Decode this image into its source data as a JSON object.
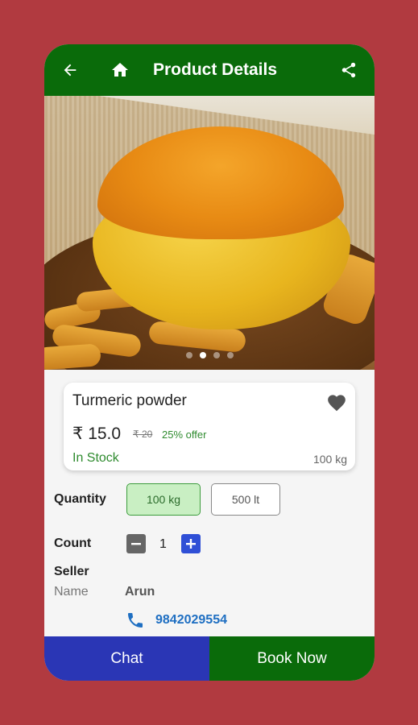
{
  "appbar": {
    "title": "Product Details",
    "back_icon": "arrow-left-icon",
    "home_icon": "home-icon",
    "share_icon": "share-icon"
  },
  "carousel": {
    "image_description": "turmeric powder in yellow bowl",
    "slides": 4,
    "active_index": 1
  },
  "product": {
    "name": "Turmeric powder",
    "price": "₹ 15.0",
    "old_price": "₹ 20",
    "offer": "25% offer",
    "stock": "In Stock",
    "weight": "100 kg"
  },
  "quantity": {
    "label": "Quantity",
    "options": [
      "100 kg",
      "500 lt"
    ],
    "selected": "100 kg"
  },
  "count": {
    "label": "Count",
    "value": "1"
  },
  "seller": {
    "label": "Seller",
    "name_key": "Name",
    "name_value": "Arun",
    "phone": "9842029554"
  },
  "actions": {
    "chat": "Chat",
    "book_now": "Book Now"
  },
  "colors": {
    "background": "#b13a40",
    "appbar": "#0a6b0a",
    "chat_button": "#2a36b5",
    "book_button": "#0a6b0a",
    "offer_green": "#2e8b2e",
    "phone_blue": "#1f6fc2"
  }
}
